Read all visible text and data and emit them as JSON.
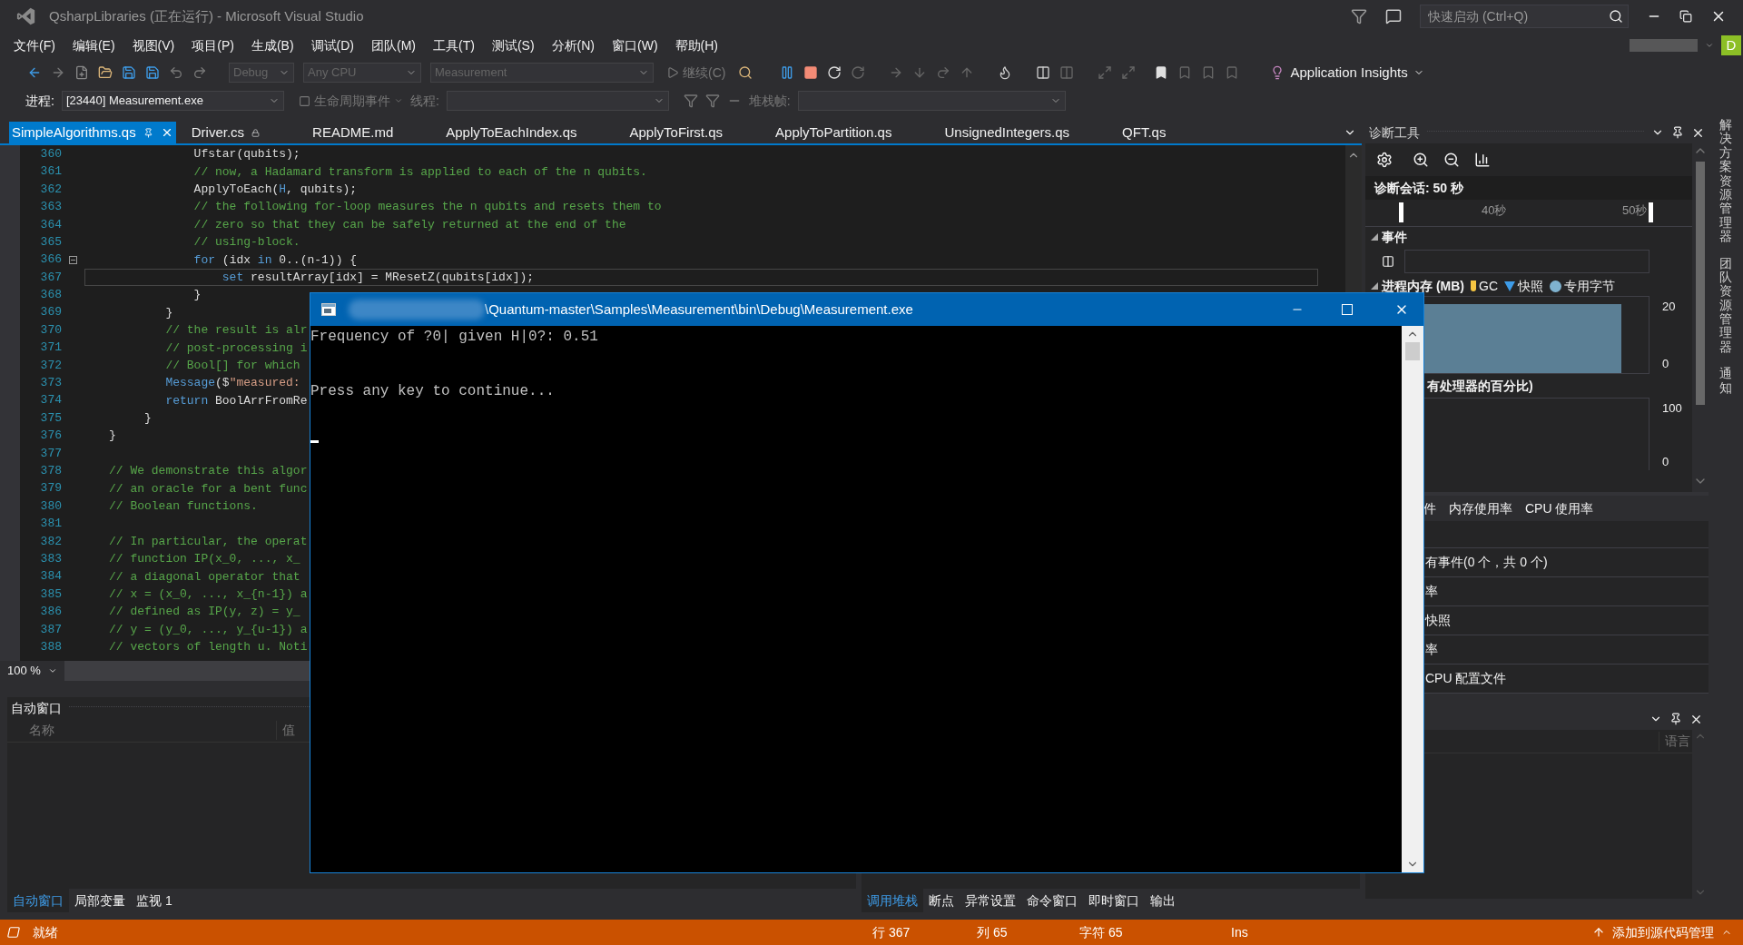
{
  "window": {
    "title": "QsharpLibraries (正在运行) - Microsoft Visual Studio"
  },
  "quick_launch": {
    "placeholder": "快速启动 (Ctrl+Q)"
  },
  "account": {
    "initial": "D"
  },
  "menu": [
    "文件(F)",
    "编辑(E)",
    "视图(V)",
    "项目(P)",
    "生成(B)",
    "调试(D)",
    "团队(M)",
    "工具(T)",
    "测试(S)",
    "分析(N)",
    "窗口(W)",
    "帮助(H)"
  ],
  "toolbar": {
    "configuration": "Debug",
    "platform": "Any CPU",
    "startup_project": "Measurement",
    "continue_button": "继续(C)",
    "application_insights": "Application Insights"
  },
  "debug_location": {
    "process_label": "进程:",
    "process": "[23440] Measurement.exe",
    "lifecycle_events": "生命周期事件",
    "thread_label": "线程:",
    "stack_frame_label": "堆栈帧:"
  },
  "document_tabs": [
    {
      "label": "SimpleAlgorithms.qs",
      "selected": true,
      "locked": false
    },
    {
      "label": "Driver.cs",
      "selected": false,
      "locked": true
    },
    {
      "label": "README.md",
      "selected": false,
      "locked": false
    },
    {
      "label": "ApplyToEachIndex.qs",
      "selected": false,
      "locked": false
    },
    {
      "label": "ApplyToFirst.qs",
      "selected": false,
      "locked": false
    },
    {
      "label": "ApplyToPartition.qs",
      "selected": false,
      "locked": false
    },
    {
      "label": "UnsignedIntegers.qs",
      "selected": false,
      "locked": false
    },
    {
      "label": "QFT.qs",
      "selected": false,
      "locked": false
    }
  ],
  "editor": {
    "zoom": "100 %",
    "lines": [
      {
        "number": "360",
        "current": false,
        "fold": false,
        "tokens": [
          {
            "text": "            Ufstar(qubits);",
            "kind": "plain"
          }
        ]
      },
      {
        "number": "361",
        "current": false,
        "fold": false,
        "tokens": [
          {
            "text": "            // now, a Hadamard transform is applied to each of the n qubits.",
            "kind": "comment"
          }
        ]
      },
      {
        "number": "362",
        "current": false,
        "fold": false,
        "tokens": [
          {
            "text": "            ApplyToEach(",
            "kind": "plain"
          },
          {
            "text": "H",
            "kind": "keyword"
          },
          {
            "text": ", qubits);",
            "kind": "plain"
          }
        ]
      },
      {
        "number": "363",
        "current": false,
        "fold": false,
        "tokens": [
          {
            "text": "            // the following for-loop measures the n qubits and resets them to",
            "kind": "comment"
          }
        ]
      },
      {
        "number": "364",
        "current": false,
        "fold": false,
        "tokens": [
          {
            "text": "            // zero so that they can be safely returned at the end of the",
            "kind": "comment"
          }
        ]
      },
      {
        "number": "365",
        "current": false,
        "fold": false,
        "tokens": [
          {
            "text": "            // using-block.",
            "kind": "comment"
          }
        ]
      },
      {
        "number": "366",
        "current": false,
        "fold": true,
        "tokens": [
          {
            "text": "            for",
            "kind": "keyword"
          },
          {
            "text": " (idx ",
            "kind": "plain"
          },
          {
            "text": "in",
            "kind": "keyword"
          },
          {
            "text": " 0..(n-1)) {",
            "kind": "plain"
          }
        ]
      },
      {
        "number": "367",
        "current": true,
        "fold": false,
        "tokens": [
          {
            "text": "                set",
            "kind": "keyword"
          },
          {
            "text": " resultArray[idx] = MResetZ(qubits[idx]);",
            "kind": "plain"
          }
        ]
      },
      {
        "number": "368",
        "current": false,
        "fold": false,
        "tokens": [
          {
            "text": "            }",
            "kind": "plain"
          }
        ]
      },
      {
        "number": "369",
        "current": false,
        "fold": false,
        "tokens": [
          {
            "text": "        }",
            "kind": "plain"
          }
        ]
      },
      {
        "number": "370",
        "current": false,
        "fold": false,
        "tokens": [
          {
            "text": "        // the result is alr",
            "kind": "comment"
          }
        ]
      },
      {
        "number": "371",
        "current": false,
        "fold": false,
        "tokens": [
          {
            "text": "        // post-processing i",
            "kind": "comment"
          }
        ]
      },
      {
        "number": "372",
        "current": false,
        "fold": false,
        "tokens": [
          {
            "text": "        // Bool[] for which",
            "kind": "comment"
          }
        ]
      },
      {
        "number": "373",
        "current": false,
        "fold": false,
        "tokens": [
          {
            "text": "        Message",
            "kind": "keyword"
          },
          {
            "text": "($",
            "kind": "plain"
          },
          {
            "text": "\"measured:",
            "kind": "string"
          }
        ]
      },
      {
        "number": "374",
        "current": false,
        "fold": false,
        "tokens": [
          {
            "text": "        return",
            "kind": "keyword"
          },
          {
            "text": " BoolArrFromRe",
            "kind": "plain"
          }
        ]
      },
      {
        "number": "375",
        "current": false,
        "fold": false,
        "tokens": [
          {
            "text": "     }",
            "kind": "plain"
          }
        ]
      },
      {
        "number": "376",
        "current": false,
        "fold": false,
        "tokens": [
          {
            "text": "}",
            "kind": "plain"
          }
        ]
      },
      {
        "number": "377",
        "current": false,
        "fold": false
      },
      {
        "number": "378",
        "current": false,
        "fold": false,
        "tokens": [
          {
            "text": "// We demonstrate this algor",
            "kind": "comment"
          }
        ]
      },
      {
        "number": "379",
        "current": false,
        "fold": false,
        "tokens": [
          {
            "text": "// an oracle for a bent func",
            "kind": "comment"
          }
        ]
      },
      {
        "number": "380",
        "current": false,
        "fold": false,
        "tokens": [
          {
            "text": "// Boolean functions.",
            "kind": "comment"
          }
        ]
      },
      {
        "number": "381",
        "current": false,
        "fold": false
      },
      {
        "number": "382",
        "current": false,
        "fold": false,
        "tokens": [
          {
            "text": "// In particular, the operat",
            "kind": "comment"
          }
        ]
      },
      {
        "number": "383",
        "current": false,
        "fold": false,
        "tokens": [
          {
            "text": "// function IP(x_0, ..., x_",
            "kind": "comment"
          }
        ]
      },
      {
        "number": "384",
        "current": false,
        "fold": false,
        "tokens": [
          {
            "text": "// a diagonal operator that",
            "kind": "comment"
          }
        ]
      },
      {
        "number": "385",
        "current": false,
        "fold": false,
        "tokens": [
          {
            "text": "// x = (x_0, ..., x_{n-1}) a",
            "kind": "comment"
          }
        ]
      },
      {
        "number": "386",
        "current": false,
        "fold": false,
        "tokens": [
          {
            "text": "// defined as IP(y, z) = y_",
            "kind": "comment"
          }
        ]
      },
      {
        "number": "387",
        "current": false,
        "fold": false,
        "tokens": [
          {
            "text": "// y = (y_0, ..., y_{u-1}) a",
            "kind": "comment"
          }
        ]
      },
      {
        "number": "388",
        "current": false,
        "fold": false,
        "tokens": [
          {
            "text": "// vectors of length u. Noti",
            "kind": "comment"
          }
        ]
      }
    ]
  },
  "autos": {
    "title": "自动窗口",
    "columns": [
      "名称",
      "值"
    ]
  },
  "bottom_left_tabs": [
    {
      "label": "自动窗口",
      "selected": true
    },
    {
      "label": "局部变量",
      "selected": false
    },
    {
      "label": "监视 1",
      "selected": false
    }
  ],
  "bottom_right_tabs": [
    {
      "label": "调用堆栈",
      "selected": true
    },
    {
      "label": "断点",
      "selected": false
    },
    {
      "label": "异常设置",
      "selected": false
    },
    {
      "label": "命令窗口",
      "selected": false
    },
    {
      "label": "即时窗口",
      "selected": false
    },
    {
      "label": "输出",
      "selected": false
    }
  ],
  "diagnostics": {
    "title": "诊断工具",
    "session": "诊断会话: 50 秒",
    "ruler_labels": [
      "40秒",
      "50秒"
    ],
    "events_heading": "事件",
    "memory": {
      "heading": "进程内存 (MB)",
      "legend": [
        {
          "label": "GC",
          "kind": "gc"
        },
        {
          "label": "快照",
          "kind": "snapshot"
        },
        {
          "label": "专用字节",
          "kind": "private"
        }
      ],
      "axis_labels": [
        "20",
        "0"
      ]
    },
    "cpu": {
      "heading": "有处理器的百分比)",
      "axis_labels": [
        "100",
        "0"
      ]
    },
    "tabs": [
      {
        "label": "件",
        "selected": false
      },
      {
        "label": "内存使用率",
        "selected": false
      },
      {
        "label": "CPU 使用率",
        "selected": false
      }
    ],
    "rows": [
      "有事件(0 个，共 0 个)",
      "率",
      "快照",
      "率",
      "CPU 配置文件"
    ]
  },
  "lower_right_panel": {
    "columns": [
      "语言"
    ]
  },
  "side_tabs": [
    "解决方案资源管理器",
    "团队资源管理器",
    "通知"
  ],
  "console": {
    "title": "\\Quantum-master\\Samples\\Measurement\\bin\\Debug\\Measurement.exe",
    "output": [
      "Frequency of ?0| given H|0?: 0.51",
      "Press any key to continue..."
    ]
  },
  "status_bar": {
    "state": "就绪",
    "line": "行 367",
    "column": "列 65",
    "char": "字符 65",
    "mode": "Ins",
    "source_control": "添加到源代码管理"
  }
}
